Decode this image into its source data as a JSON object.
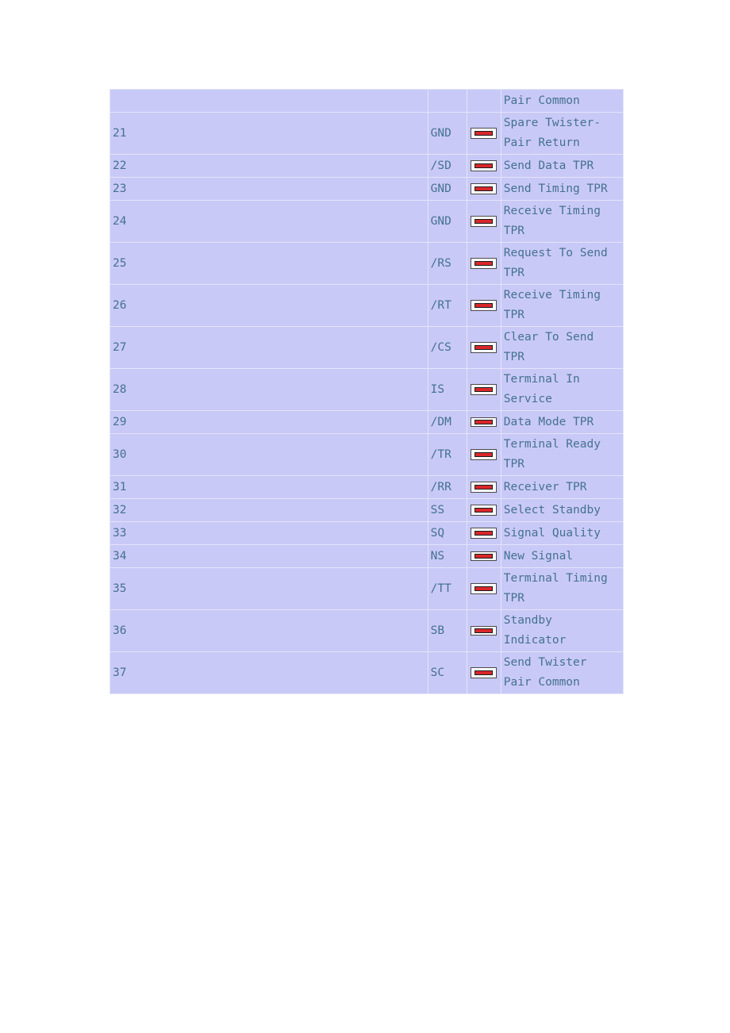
{
  "document": {
    "background_color": "#ffffff",
    "table_background_color": "#c9c9f7",
    "text_color": "#44728f",
    "border_color": "#e4e4fb"
  },
  "table": {
    "name": "connector-pinout-table",
    "columns": [
      "pin",
      "signal",
      "icon",
      "description"
    ],
    "rows": [
      {
        "pin": "",
        "signal": "",
        "icon": "",
        "description": "Pair Common",
        "height": "partial"
      },
      {
        "pin": "21",
        "signal": "GND",
        "icon": "broken-image-icon",
        "description": "Spare Twister-Pair Return",
        "height": "tall"
      },
      {
        "pin": "22",
        "signal": "/SD",
        "icon": "broken-image-icon",
        "description": "Send Data TPR",
        "height": "normal"
      },
      {
        "pin": "23",
        "signal": "GND",
        "icon": "broken-image-icon",
        "description": "Send Timing TPR",
        "height": "normal"
      },
      {
        "pin": "24",
        "signal": "GND",
        "icon": "broken-image-icon",
        "description": "Receive Timing TPR",
        "height": "tall"
      },
      {
        "pin": "25",
        "signal": "/RS",
        "icon": "broken-image-icon",
        "description": "Request To Send TPR",
        "height": "tall"
      },
      {
        "pin": "26",
        "signal": "/RT",
        "icon": "broken-image-icon",
        "description": "Receive Timing TPR",
        "height": "tall"
      },
      {
        "pin": "27",
        "signal": "/CS",
        "icon": "broken-image-icon",
        "description": "Clear To Send TPR",
        "height": "tall"
      },
      {
        "pin": "28",
        "signal": "IS",
        "icon": "broken-image-icon",
        "description": "Terminal In Service",
        "height": "tall"
      },
      {
        "pin": "29",
        "signal": "/DM",
        "icon": "broken-image-icon-short",
        "description": "Data Mode TPR",
        "height": "normal"
      },
      {
        "pin": "30",
        "signal": "/TR",
        "icon": "broken-image-icon",
        "description": "Terminal Ready TPR",
        "height": "tall"
      },
      {
        "pin": "31",
        "signal": "/RR",
        "icon": "broken-image-icon",
        "description": "Receiver TPR",
        "height": "normal"
      },
      {
        "pin": "32",
        "signal": "SS",
        "icon": "broken-image-icon",
        "description": "Select Standby",
        "height": "normal"
      },
      {
        "pin": "33",
        "signal": "SQ",
        "icon": "broken-image-icon",
        "description": "Signal Quality",
        "height": "normal"
      },
      {
        "pin": "34",
        "signal": "NS",
        "icon": "broken-image-icon-short",
        "description": "New Signal",
        "height": "normal"
      },
      {
        "pin": "35",
        "signal": "/TT",
        "icon": "broken-image-icon",
        "description": "Terminal Timing TPR",
        "height": "tall"
      },
      {
        "pin": "36",
        "signal": "SB",
        "icon": "broken-image-icon-short",
        "description": "Standby Indicator",
        "height": "tall"
      },
      {
        "pin": "37",
        "signal": "SC",
        "icon": "broken-image-icon",
        "description": "Send Twister Pair Common",
        "height": "tall"
      }
    ]
  }
}
